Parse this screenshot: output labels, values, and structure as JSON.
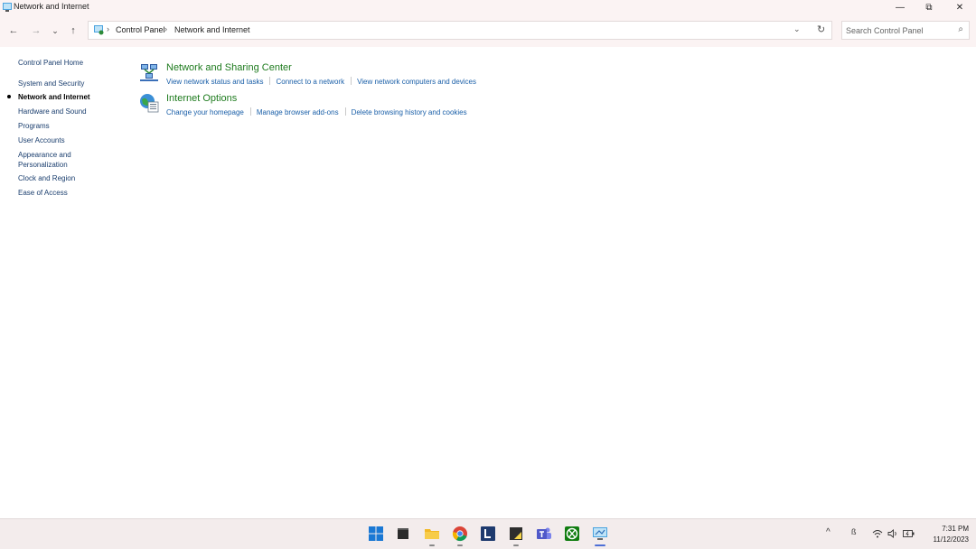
{
  "window": {
    "title": "Network and Internet",
    "controls": {
      "minimize": "—",
      "maximize": "⧉",
      "close": "✕"
    }
  },
  "nav": {
    "back_icon": "←",
    "forward_icon": "→",
    "recent_icon": "⌄",
    "up_icon": "↑"
  },
  "address": {
    "sep": "›",
    "crumbs": [
      "Control Panel",
      "Network and Internet"
    ],
    "dropdown_icon": "⌄",
    "refresh_icon": "↻"
  },
  "search": {
    "placeholder": "Search Control Panel",
    "icon": "⌕"
  },
  "sidebar": {
    "items": [
      {
        "label": "Control Panel Home",
        "current": false
      },
      {
        "label": "System and Security",
        "current": false
      },
      {
        "label": "Network and Internet",
        "current": true
      },
      {
        "label": "Hardware and Sound",
        "current": false
      },
      {
        "label": "Programs",
        "current": false
      },
      {
        "label": "User Accounts",
        "current": false
      },
      {
        "label": "Appearance and",
        "label2": "Personalization",
        "current": false
      },
      {
        "label": "Clock and Region",
        "current": false
      },
      {
        "label": "Ease of Access",
        "current": false
      }
    ]
  },
  "categories": [
    {
      "title": "Network and Sharing Center",
      "icon": "network-sharing-icon",
      "links": [
        "View network status and tasks",
        "Connect to a network",
        "View network computers and devices"
      ]
    },
    {
      "title": "Internet Options",
      "icon": "internet-options-icon",
      "links": [
        "Change your homepage",
        "Manage browser add-ons",
        "Delete browsing history and cookies"
      ]
    }
  ],
  "taskbar": {
    "apps": [
      "start-icon",
      "terminal-icon",
      "file-explorer-icon",
      "chrome-icon",
      "l-app-icon",
      "sticky-notes-icon",
      "teams-icon",
      "xbox-icon",
      "control-panel-icon"
    ],
    "tray": {
      "chevron": "^",
      "lang": "ß",
      "wifi": "wifi-icon",
      "volume": "volume-icon",
      "battery": "battery-icon"
    },
    "time": "7:31 PM",
    "date": "11/12/2023"
  },
  "colors": {
    "category_title": "#1e7b1e",
    "link": "#1a5fa8",
    "sidebar_link": "#1a3e6e",
    "chrome_bg": "#fbf3f3",
    "taskbar_bg": "#f3ecec"
  }
}
